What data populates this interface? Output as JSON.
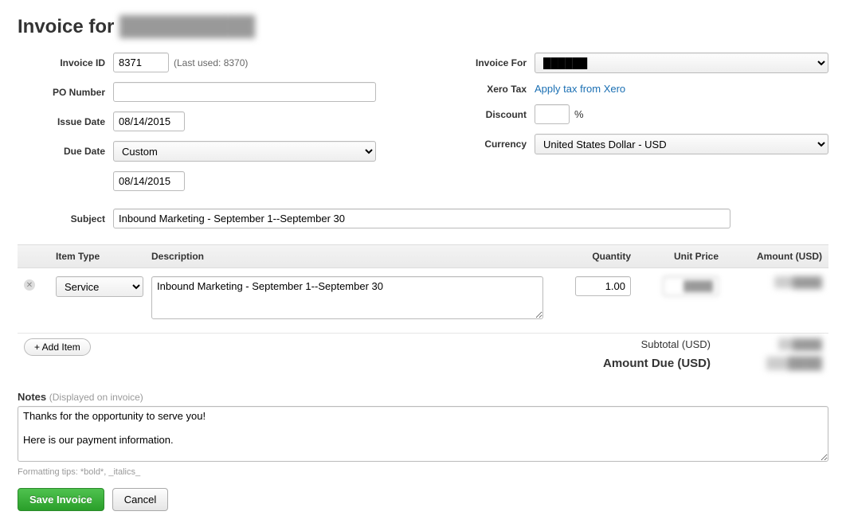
{
  "page_title_prefix": "Invoice for",
  "client_name_redacted": "██████████",
  "left": {
    "invoice_id_label": "Invoice ID",
    "invoice_id_value": "8371",
    "invoice_id_hint": "(Last used: 8370)",
    "po_number_label": "PO Number",
    "po_number_value": "",
    "issue_date_label": "Issue Date",
    "issue_date_value": "08/14/2015",
    "due_date_label": "Due Date",
    "due_date_select": "Custom",
    "due_date_value": "08/14/2015"
  },
  "right": {
    "invoice_for_label": "Invoice For",
    "invoice_for_value": "██████",
    "xero_tax_label": "Xero Tax",
    "xero_tax_link": "Apply tax from Xero",
    "discount_label": "Discount",
    "discount_value": "",
    "discount_unit": "%",
    "currency_label": "Currency",
    "currency_value": "United States Dollar - USD"
  },
  "subject": {
    "label": "Subject",
    "value": "Inbound Marketing - September 1--September 30"
  },
  "columns": {
    "item_type": "Item Type",
    "description": "Description",
    "quantity": "Quantity",
    "unit_price": "Unit Price",
    "amount": "Amount (USD)"
  },
  "line_items": [
    {
      "type": "Service",
      "description": "Inbound Marketing - September 1--September 30",
      "quantity": "1.00",
      "unit_price_redacted": "████",
      "amount_redacted": "████"
    }
  ],
  "add_item_label": "+ Add Item",
  "totals": {
    "subtotal_label": "Subtotal (USD)",
    "subtotal_redacted": "████",
    "amount_due_label": "Amount Due (USD)",
    "amount_due_redacted": "████"
  },
  "notes": {
    "label": "Notes",
    "sublabel": "(Displayed on invoice)",
    "value": "Thanks for the opportunity to serve you!\n\nHere is our payment information.",
    "format_hint": "Formatting tips: *bold*, _italics_"
  },
  "actions": {
    "save": "Save Invoice",
    "cancel": "Cancel"
  }
}
